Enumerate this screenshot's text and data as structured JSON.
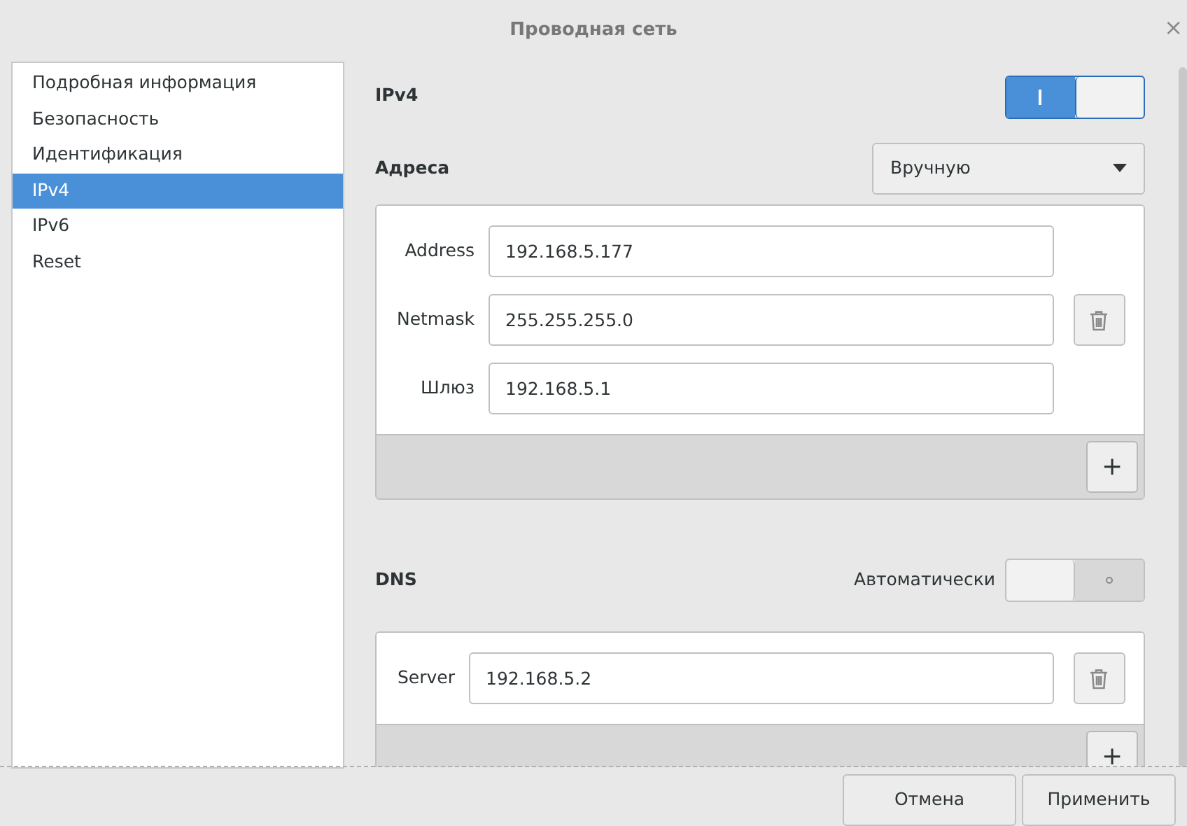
{
  "window": {
    "title": "Проводная сеть",
    "close": "×"
  },
  "sidebar": {
    "items": [
      {
        "label": "Подробная информация",
        "selected": false
      },
      {
        "label": "Безопасность",
        "selected": false
      },
      {
        "label": "Идентификация",
        "selected": false
      },
      {
        "label": "IPv4",
        "selected": true
      },
      {
        "label": "IPv6",
        "selected": false
      },
      {
        "label": "Reset",
        "selected": false
      }
    ]
  },
  "ipv4": {
    "label": "IPv4",
    "on": true
  },
  "addresses": {
    "label": "Адреса",
    "method": "Вручную",
    "fields": [
      {
        "label": "Address",
        "value": "192.168.5.177",
        "removable": false
      },
      {
        "label": "Netmask",
        "value": "255.255.255.0",
        "removable": true
      },
      {
        "label": "Шлюз",
        "value": "192.168.5.1",
        "removable": false
      }
    ],
    "add": "+"
  },
  "dns": {
    "label": "DNS",
    "auto_label": "Автоматически",
    "auto": false,
    "fields": [
      {
        "label": "Server",
        "value": "192.168.5.2",
        "removable": true
      }
    ],
    "add": "+"
  },
  "buttons": [
    {
      "label": "Отмена"
    },
    {
      "label": "Применить"
    }
  ]
}
